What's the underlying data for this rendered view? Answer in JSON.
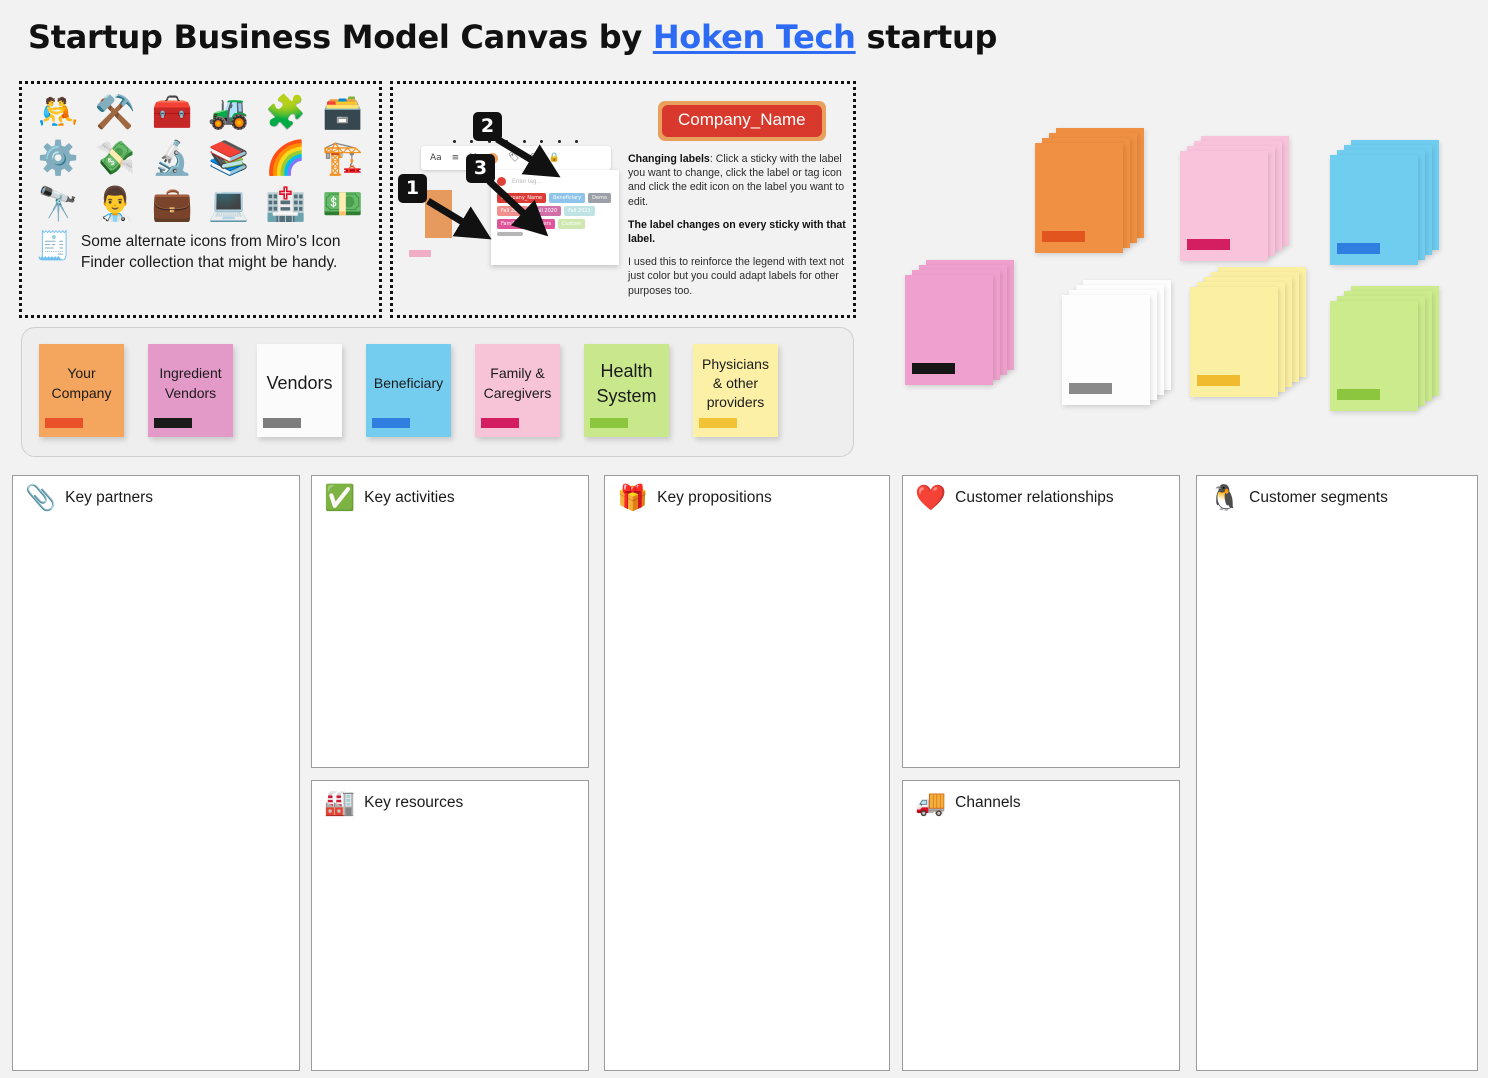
{
  "title": {
    "part1": "Startup Business Model Canvas by ",
    "link": "Hoken Tech",
    "part2": " startup"
  },
  "icon_panel": {
    "icons": [
      {
        "name": "people-wrestling-icon",
        "glyph": "🤼"
      },
      {
        "name": "hammer-and-pick-icon",
        "glyph": "⚒️"
      },
      {
        "name": "toolbox-icon",
        "glyph": "🧰"
      },
      {
        "name": "tractor-icon",
        "glyph": "🚜"
      },
      {
        "name": "puzzle-piece-icon",
        "glyph": "🧩"
      },
      {
        "name": "card-file-box-icon",
        "glyph": "🗃️"
      },
      {
        "name": "gear-icon",
        "glyph": "⚙️"
      },
      {
        "name": "money-with-wings-icon",
        "glyph": "💸"
      },
      {
        "name": "microscope-icon",
        "glyph": "🔬"
      },
      {
        "name": "books-icon",
        "glyph": "📚"
      },
      {
        "name": "rainbow-icon",
        "glyph": "🌈"
      },
      {
        "name": "building-construction-icon",
        "glyph": "🏗️"
      },
      {
        "name": "telescope-icon",
        "glyph": "🔭"
      },
      {
        "name": "health-worker-icon",
        "glyph": "👨‍⚕️"
      },
      {
        "name": "luggage-icon",
        "glyph": "💼"
      },
      {
        "name": "laptop-icon",
        "glyph": "💻"
      },
      {
        "name": "hospital-icon",
        "glyph": "🏥"
      },
      {
        "name": "dollar-banknote-icon",
        "glyph": "💵"
      }
    ],
    "receipt_icon": "🧾",
    "note": "Some alternate icons from Miro's Icon Finder collection that might be handy."
  },
  "howto_panel": {
    "badge_label": "Company_Name",
    "callouts": [
      "1",
      "2",
      "3"
    ],
    "paragraphs": [
      {
        "bold": "Changing labels",
        "rest": ": Click a sticky with the label you want to change, click the label or tag icon and click the edit icon on the label you want to edit."
      },
      {
        "bold": "The label changes on every sticky with that label.",
        "rest": ""
      },
      {
        "bold": "",
        "rest": "I used this to reinforce the legend with text not just color but you could adapt labels for other purposes too."
      }
    ],
    "mini": {
      "toolbar_items": [
        "Aa",
        "≡",
        "M"
      ],
      "tag_icon": "🏷",
      "emoji_icon": "☺",
      "lock_icon": "🔒",
      "placeholder": "Enter tag...",
      "chips": [
        {
          "label": "Company_Name",
          "color": "#dc3b36"
        },
        {
          "label": "Beneficiary",
          "color": "#8ec4ea"
        },
        {
          "label": "Demo",
          "color": "#9aa0a6"
        },
        {
          "label": "Fall 2019",
          "color": "#f1908d"
        },
        {
          "label": "Fall 2020",
          "color": "#d26fa8"
        },
        {
          "label": "Fall 2021",
          "color": "#bfe3e3"
        },
        {
          "label": "Family & Caregivers",
          "color": "#e0559a"
        },
        {
          "label": "Custom",
          "color": "#cfe8b0"
        },
        {
          "label": "",
          "color": "#b5b5b5"
        }
      ]
    }
  },
  "legend": {
    "stickies": [
      {
        "label": "Your Company",
        "bg": "#f4a55e",
        "tag": "#e8512a",
        "big": false
      },
      {
        "label": "Ingredient Vendors",
        "bg": "#e39ac8",
        "tag": "#1a1a1a",
        "big": false
      },
      {
        "label": "Vendors",
        "bg": "#fbfbfb",
        "tag": "#7d7d7d",
        "big": true
      },
      {
        "label": "Beneficiary",
        "bg": "#74cdee",
        "tag": "#2f7fe0",
        "big": false
      },
      {
        "label": "Family & Caregivers",
        "bg": "#f7c4d7",
        "tag": "#d31f62",
        "big": false
      },
      {
        "label": "Health System",
        "bg": "#c9e88c",
        "tag": "#8cc63f",
        "big": true
      },
      {
        "label": "Physicians & other providers",
        "bg": "#fbf0a6",
        "tag": "#f0c234",
        "big": false
      }
    ]
  },
  "stacks": [
    {
      "name": "orange-sticky-stack",
      "bg": "#ef9042",
      "tag": "#e2551f",
      "sheets": 4
    },
    {
      "name": "pink-light-sticky-stack",
      "bg": "#f9c3dc",
      "tag": "#d31f62",
      "sheets": 4
    },
    {
      "name": "blue-sticky-stack",
      "bg": "#6fcdf0",
      "tag": "#2f7fe0",
      "sheets": 4
    },
    {
      "name": "pink-sticky-stack",
      "bg": "#f0a0ce",
      "tag": "#161616",
      "sheets": 4
    },
    {
      "name": "white-sticky-stack",
      "bg": "#fdfdfd",
      "tag": "#8a8a8a",
      "sheets": 4
    },
    {
      "name": "yellow-sticky-stack",
      "bg": "#fbefa2",
      "tag": "#f0bb2e",
      "sheets": 5
    },
    {
      "name": "green-sticky-stack",
      "bg": "#cbeb8c",
      "tag": "#8cc63f",
      "sheets": 4
    }
  ],
  "canvas": {
    "blocks": [
      {
        "key": "key-partners",
        "title": "Key partners",
        "icon": "📎"
      },
      {
        "key": "key-activities",
        "title": "Key activities",
        "icon": "✅"
      },
      {
        "key": "key-resources",
        "title": "Key resources",
        "icon": "🏭"
      },
      {
        "key": "key-propositions",
        "title": "Key propositions",
        "icon": "🎁"
      },
      {
        "key": "customer-relationships",
        "title": "Customer relationships",
        "icon": "❤️"
      },
      {
        "key": "channels",
        "title": "Channels",
        "icon": "🚚"
      },
      {
        "key": "customer-segments",
        "title": "Customer segments",
        "icon": "🐧"
      }
    ]
  }
}
